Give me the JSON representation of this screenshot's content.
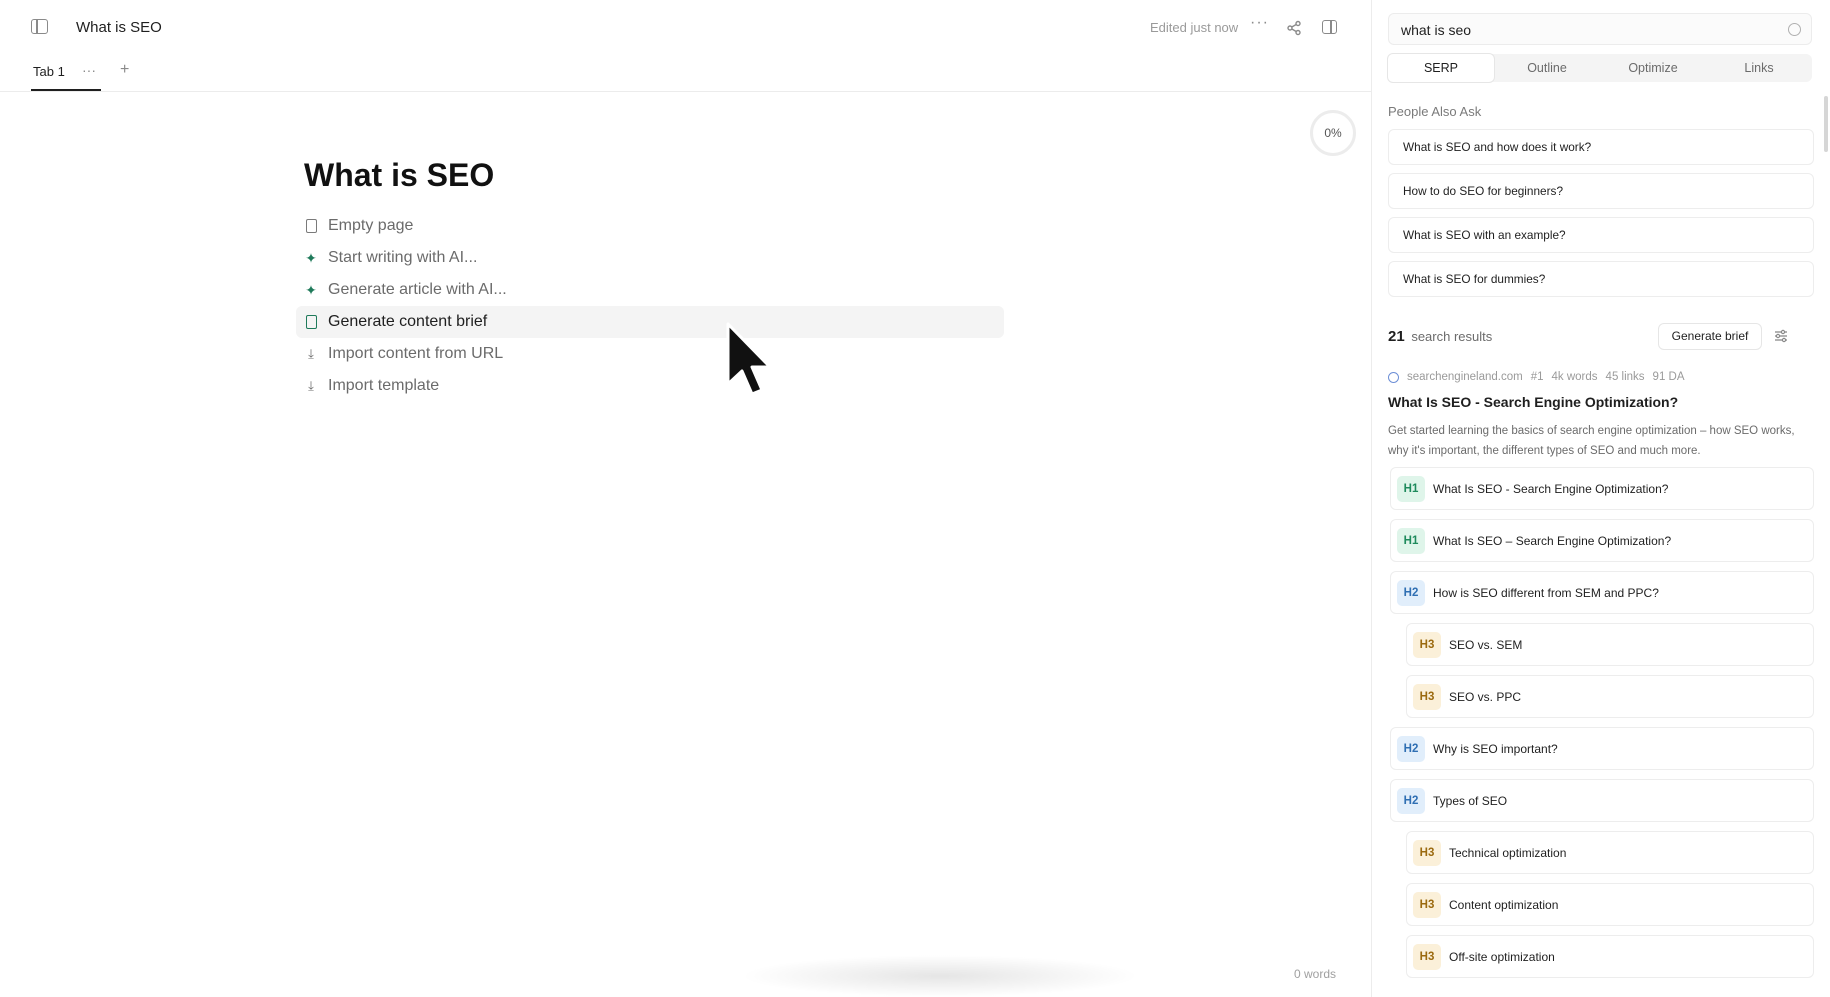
{
  "header": {
    "doc_title": "What is SEO",
    "edited_status": "Edited just now",
    "more": "···"
  },
  "tabs": {
    "active_tab": "Tab 1",
    "more": "···",
    "add": "+"
  },
  "editor": {
    "progress": "0%",
    "heading": "What is SEO",
    "menu": [
      {
        "label": "Empty page",
        "icon": "page-icon"
      },
      {
        "label": "Start writing with AI...",
        "icon": "sparkle-icon"
      },
      {
        "label": "Generate article with AI...",
        "icon": "sparkle-icon"
      },
      {
        "label": "Generate content brief",
        "icon": "brief-icon",
        "active": true
      },
      {
        "label": "Import content from URL",
        "icon": "download-icon"
      },
      {
        "label": "Import template",
        "icon": "download-icon"
      }
    ],
    "word_count": "0 words"
  },
  "panel": {
    "search_value": "what is seo",
    "tabs": [
      "SERP",
      "Outline",
      "Optimize",
      "Links"
    ],
    "active_tab": "SERP",
    "paa_title": "People Also Ask",
    "paa": [
      "What is SEO and how does it work?",
      "How to do SEO for beginners?",
      "What is SEO with an example?",
      "What is SEO for dummies?"
    ],
    "results_count": "21",
    "results_label": "search results",
    "generate_brief": "Generate brief",
    "result": {
      "domain": "searchengineland.com",
      "rank": "#1",
      "words": "4k words",
      "links": "45 links",
      "da": "91 DA",
      "title": "What Is SEO - Search Engine Optimization?",
      "description": "Get started learning the basics of search engine optimization – how SEO works, why it's important, the different types of SEO and much more.",
      "outline": [
        {
          "level": "H1",
          "text": "What Is SEO - Search Engine Optimization?"
        },
        {
          "level": "H1",
          "text": "What Is SEO – Search Engine Optimization?"
        },
        {
          "level": "H2",
          "text": "How is SEO different from SEM and PPC?"
        },
        {
          "level": "H3",
          "text": "SEO vs. SEM"
        },
        {
          "level": "H3",
          "text": "SEO vs. PPC"
        },
        {
          "level": "H2",
          "text": "Why is SEO important?"
        },
        {
          "level": "H2",
          "text": "Types of SEO"
        },
        {
          "level": "H3",
          "text": "Technical optimization"
        },
        {
          "level": "H3",
          "text": "Content optimization"
        },
        {
          "level": "H3",
          "text": "Off-site optimization"
        }
      ]
    }
  },
  "colors": {
    "accent_green": "#1e8a5c",
    "h2_blue": "#2f6fb3",
    "h3_amber": "#9b6a10"
  }
}
